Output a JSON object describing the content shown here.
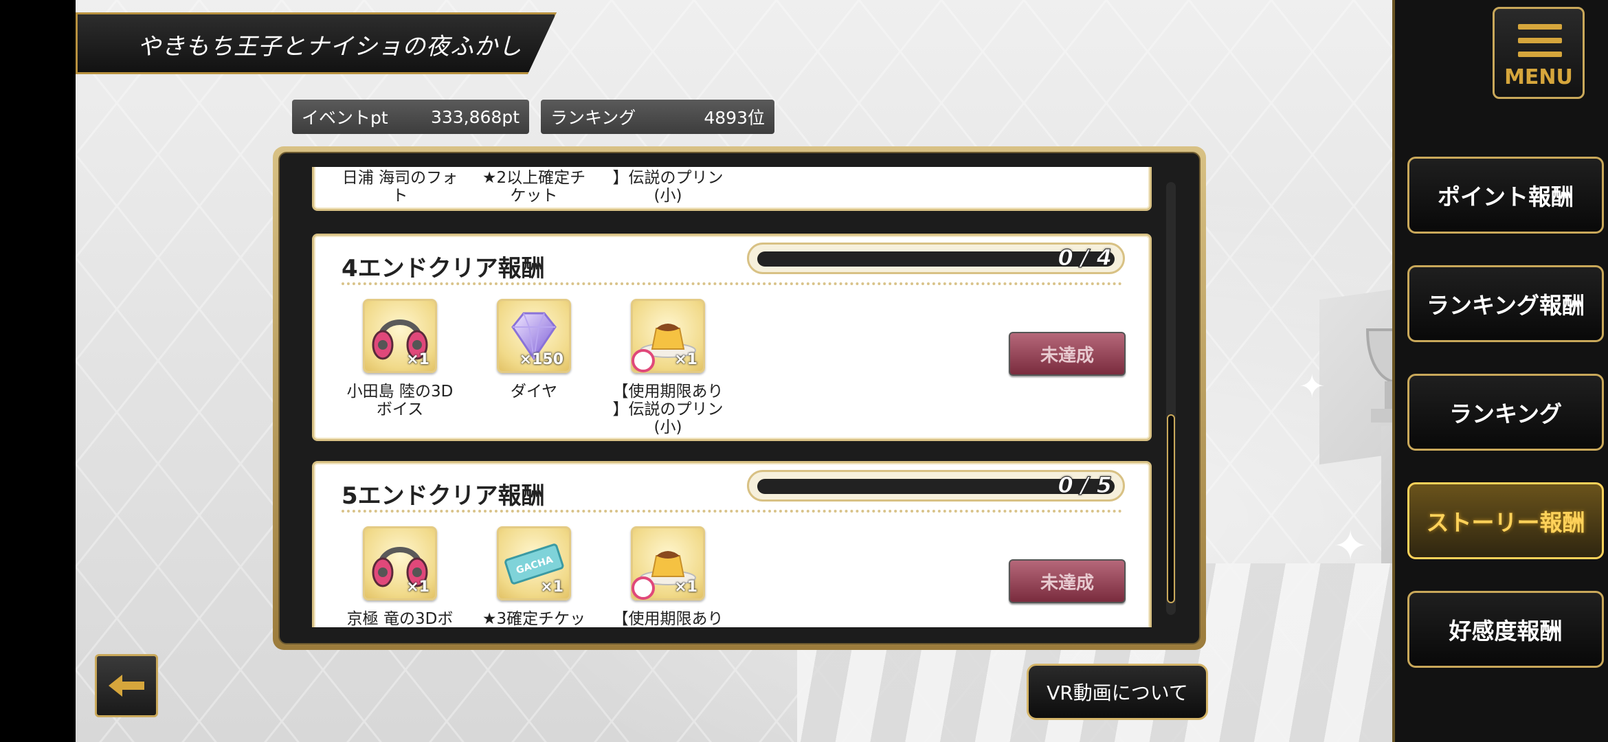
{
  "event_title": "やきもち王子とナイショの夜ふかし",
  "stats": {
    "event_pt_label": "イベントpt",
    "event_pt_value": "333,868pt",
    "ranking_label": "ランキング",
    "ranking_value": "4893位"
  },
  "rewards": {
    "partial_card": {
      "items": [
        {
          "name": "日浦 海司のフォ\nト"
        },
        {
          "name": "★2以上確定チ\nケット"
        },
        {
          "name": "】伝説のプリン\n(小)"
        }
      ]
    },
    "cards": [
      {
        "title": "4エンドクリア報酬",
        "progress_text": "0 / 4",
        "progress": 0.0,
        "items": [
          {
            "icon": "headphones-icon",
            "qty": "×1",
            "name": "小田島 陸の3D\nボイス"
          },
          {
            "icon": "diamond-icon",
            "qty": "×150",
            "name": "ダイヤ"
          },
          {
            "icon": "pudding-icon",
            "qty": "×1",
            "name": "【使用期限あり\n】伝説のプリン\n(小)"
          }
        ],
        "status": "未達成"
      },
      {
        "title": "5エンドクリア報酬",
        "progress_text": "0 / 5",
        "progress": 0.0,
        "items": [
          {
            "icon": "headphones-icon",
            "qty": "×1",
            "name": "京極 竜の3Dボ"
          },
          {
            "icon": "gacha-ticket-icon",
            "qty": "×1",
            "ticket_text": "GACHA",
            "name": "★3確定チケッ"
          },
          {
            "icon": "pudding-icon",
            "qty": "×1",
            "name": "【使用期限あり"
          }
        ],
        "status": "未達成"
      }
    ]
  },
  "buttons": {
    "vr_label": "VR動画について"
  },
  "sidebar": {
    "menu_label": "MENU",
    "items": [
      {
        "label": "ポイント報酬",
        "active": false
      },
      {
        "label": "ランキング報酬",
        "active": false
      },
      {
        "label": "ランキング",
        "active": false
      },
      {
        "label": "ストーリー報酬",
        "active": true
      },
      {
        "label": "好感度報酬",
        "active": false
      }
    ]
  },
  "colors": {
    "gold": "#c9a85a",
    "active_gold": "#ffd25a",
    "unachieved": "#7a2c3e"
  }
}
